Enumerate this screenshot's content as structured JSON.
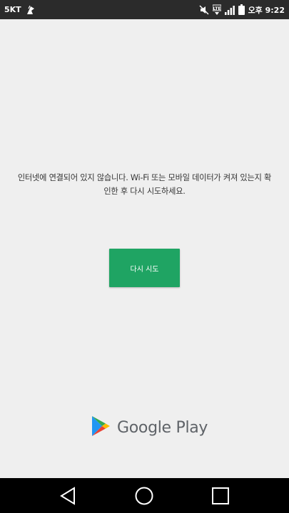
{
  "status_bar": {
    "carrier": "5KT",
    "clock": "오후 9:22",
    "icons": [
      "notification-icon",
      "mute-icon",
      "lte-icon",
      "signal-icon",
      "battery-icon"
    ]
  },
  "main": {
    "message": "인터넷에 연결되어 있지 않습니다. Wi-Fi 또는 모바일 데이터가 켜져 있는지 확인한 후 다시 시도하세요.",
    "retry_label": "다시 시도"
  },
  "footer": {
    "brand": "Google Play",
    "icon": "google-play-logo"
  },
  "nav_bar": {
    "icons": [
      "back-icon",
      "home-icon",
      "recents-icon"
    ]
  },
  "colors": {
    "button": "#1fa463",
    "background": "#efefef",
    "status_bar": "#2b2b2b",
    "nav_bar": "#000000"
  }
}
